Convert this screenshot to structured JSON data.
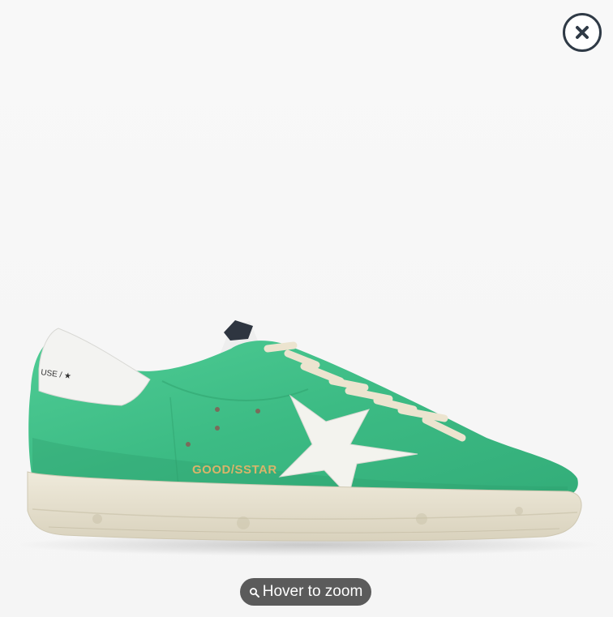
{
  "viewer": {
    "hint_label": "Hover to zoom",
    "hint_icon": "magnifier-icon",
    "close_icon": "close-icon"
  },
  "product": {
    "image_description": "green-suede-sneaker-with-white-star",
    "side_print": "GOOD/SSTAR",
    "heel_print": "USE / ★",
    "colors": {
      "suede": "#3fbf88",
      "star": "#f4f4ef",
      "heel": "#f4f4f2",
      "sole": "#e8e3d3",
      "laces": "#ece4cf",
      "lettering": "#d9b46a"
    }
  }
}
